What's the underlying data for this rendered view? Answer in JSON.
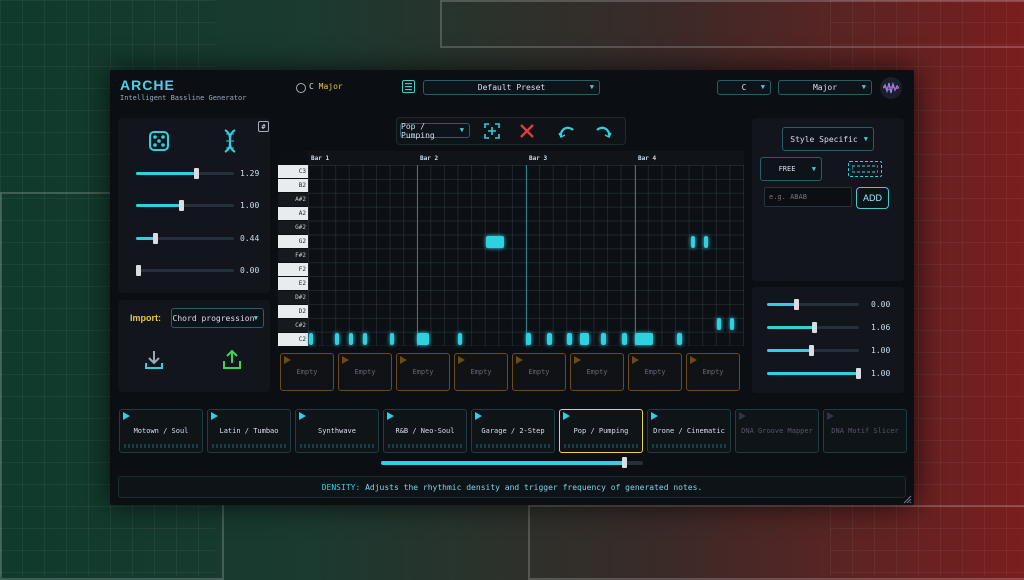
{
  "header": {
    "brand": "ARCHE",
    "subtitle": "Intelligent Bassline Generator",
    "key_prefix": "C",
    "key_scale": "Major",
    "preset": "Default Preset",
    "root_select": "C",
    "scale_select": "Major"
  },
  "left": {
    "hash_label": "#",
    "sliders": [
      {
        "value": "1.29",
        "fraction": 0.62
      },
      {
        "value": "1.00",
        "fraction": 0.47
      },
      {
        "value": "0.44",
        "fraction": 0.2
      },
      {
        "value": "0.00",
        "fraction": 0.0
      }
    ],
    "import_label": "Import:",
    "import_select": "Chord progression"
  },
  "toolbar": {
    "style_select": "Pop / Pumping"
  },
  "roll": {
    "bars": [
      "Bar 1",
      "Bar 2",
      "Bar 3",
      "Bar 4"
    ],
    "keys": [
      {
        "label": "C3",
        "type": "w"
      },
      {
        "label": "B2",
        "type": "w"
      },
      {
        "label": "A#2",
        "type": "b"
      },
      {
        "label": "A2",
        "type": "w"
      },
      {
        "label": "G#2",
        "type": "b"
      },
      {
        "label": "G2",
        "type": "w"
      },
      {
        "label": "F#2",
        "type": "b"
      },
      {
        "label": "F2",
        "type": "w"
      },
      {
        "label": "E2",
        "type": "w"
      },
      {
        "label": "D#2",
        "type": "b"
      },
      {
        "label": "D2",
        "type": "w"
      },
      {
        "label": "C#2",
        "type": "b"
      },
      {
        "label": "C2",
        "type": "w"
      }
    ]
  },
  "slots": [
    "Empty",
    "Empty",
    "Empty",
    "Empty",
    "Empty",
    "Empty",
    "Empty",
    "Empty"
  ],
  "right": {
    "style_select": "Style Specific",
    "mode_select": "FREE",
    "input_placeholder": "e.g. ABAB",
    "add_label": "ADD",
    "sliders": [
      {
        "value": "0.00",
        "fraction": 0.33
      },
      {
        "value": "1.06",
        "fraction": 0.52
      },
      {
        "value": "1.00",
        "fraction": 0.49
      },
      {
        "value": "1.00",
        "fraction": 1.0
      }
    ]
  },
  "styles": [
    {
      "label": "Motown / Soul",
      "state": "normal"
    },
    {
      "label": "Latin / Tumbao",
      "state": "normal"
    },
    {
      "label": "Synthwave",
      "state": "normal"
    },
    {
      "label": "R&B / Neo-Soul",
      "state": "normal"
    },
    {
      "label": "Garage / 2-Step",
      "state": "normal"
    },
    {
      "label": "Pop / Pumping",
      "state": "active"
    },
    {
      "label": "Drone / Cinematic",
      "state": "normal"
    },
    {
      "label": "DNA Groove Mapper",
      "state": "dim"
    },
    {
      "label": "DNA Motif Slicer",
      "state": "dim"
    }
  ],
  "bottom_slider_fraction": 0.93,
  "status": {
    "keyword": "DENSITY:",
    "text": "Adjusts the rhythmic density and trigger frequency of generated notes."
  },
  "colors": {
    "accent": "#2fd1e0",
    "active_border": "#e8d44a",
    "red": "#e23b3b",
    "green": "#3fd25a"
  }
}
